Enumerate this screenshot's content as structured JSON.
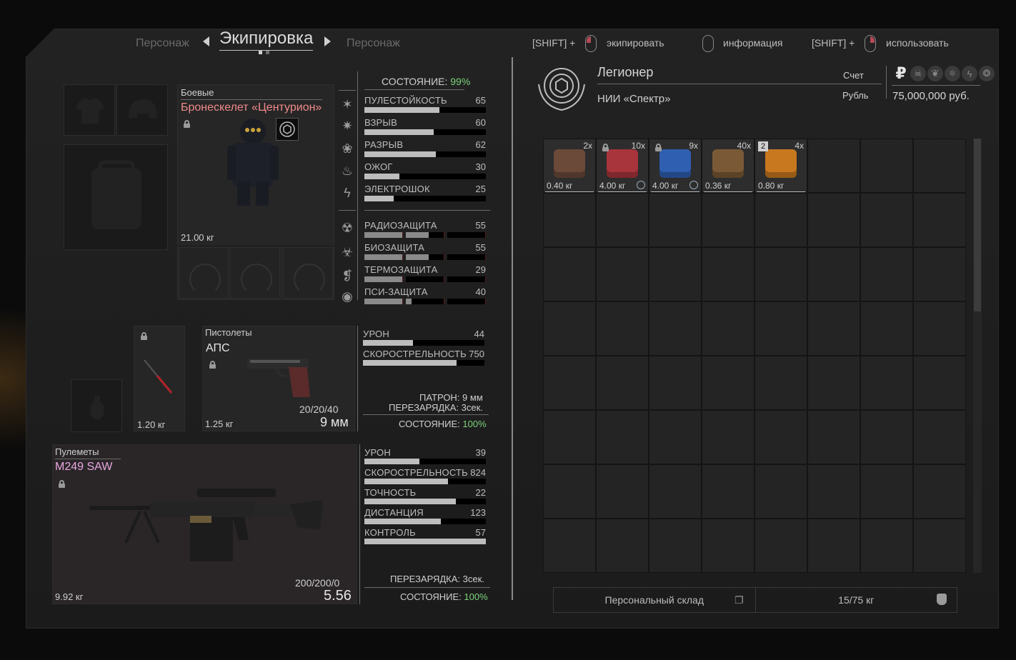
{
  "nav": {
    "left_tab": "Персонаж",
    "current_tab": "Экипировка",
    "right_tab": "Персонаж"
  },
  "hints": [
    {
      "prefix": "[SHIFT] +",
      "label": "экипировать"
    },
    {
      "prefix": "",
      "label": "информация"
    },
    {
      "prefix": "[SHIFT] +",
      "label": "использовать"
    }
  ],
  "profile": {
    "name": "Легионер",
    "faction": "НИИ «Спектр»",
    "account_label": "Счет",
    "currency_label": "Рубль",
    "balance": "75,000,000 руб.",
    "currency_symbol": "₽"
  },
  "armor": {
    "category": "Боевые",
    "name": "Бронескелет «Центурион»",
    "weight": "21.00 кг",
    "condition_label": "СОСТОЯНИЕ:",
    "condition_value": "99%",
    "protection": [
      {
        "label": "ПУЛЕСТОЙКОСТЬ",
        "value": "65",
        "fill": 0.62
      },
      {
        "label": "ВЗРЫВ",
        "value": "60",
        "fill": 0.57
      },
      {
        "label": "РАЗРЫВ",
        "value": "62",
        "fill": 0.59
      },
      {
        "label": "ОЖОГ",
        "value": "30",
        "fill": 0.29
      },
      {
        "label": "ЭЛЕКТРОШОК",
        "value": "25",
        "fill": 0.24
      }
    ],
    "resistance": [
      {
        "label": "РАДИОЗАЩИТА",
        "value": "55",
        "fill": [
          1.0,
          0.6,
          0.0
        ]
      },
      {
        "label": "БИОЗАЩИТА",
        "value": "55",
        "fill": [
          1.0,
          0.6,
          0.0
        ]
      },
      {
        "label": "ТЕРМОЗАЩИТА",
        "value": "29",
        "fill": [
          1.0,
          0.0,
          0.0
        ]
      },
      {
        "label": "ПСИ-ЗАЩИТА",
        "value": "40",
        "fill": [
          1.0,
          0.15,
          0.0
        ]
      }
    ]
  },
  "knife": {
    "weight": "1.20 кг"
  },
  "pistol": {
    "category": "Пистолеты",
    "name": "АПС",
    "weight": "1.25 кг",
    "ammo": "20/20/40",
    "caliber": "9 мм",
    "stats": [
      {
        "label": "УРОН",
        "value": "44",
        "fill": 0.41
      },
      {
        "label": "СКОРОСТРЕЛЬНОСТЬ",
        "value": "750",
        "fill": 0.77
      }
    ],
    "ammo_label": "ПАТРОН: 9 мм",
    "reload_label": "ПЕРЕЗАРЯДКА: 3сек.",
    "condition_label": "СОСТОЯНИЕ:",
    "condition_value": "100%"
  },
  "mg": {
    "category": "Пулеметы",
    "name": "M249 SAW",
    "weight": "9.92 кг",
    "ammo": "200/200/0",
    "caliber": "5.56",
    "stats": [
      {
        "label": "УРОН",
        "value": "39",
        "fill": 0.45
      },
      {
        "label": "СКОРОСТРЕЛЬНОСТЬ",
        "value": "824",
        "fill": 0.69
      },
      {
        "label": "ТОЧНОСТЬ",
        "value": "22",
        "fill": 0.75
      },
      {
        "label": "ДИСТАНЦИЯ",
        "value": "123",
        "fill": 0.63
      },
      {
        "label": "КОНТРОЛЬ",
        "value": "57",
        "fill": 1.0
      }
    ],
    "reload_label": "ПЕРЕЗАРЯДКА: 3сек.",
    "condition_label": "СОСТОЯНИЕ:",
    "condition_value": "100%"
  },
  "inventory": {
    "items": [
      {
        "count": "2x",
        "weight": "0.40 кг",
        "icon": "tape-roll-icon",
        "locked": false,
        "timer": false,
        "color": "#6b4a3a"
      },
      {
        "count": "10x",
        "weight": "4.00 кг",
        "icon": "red-medkit-icon",
        "locked": true,
        "timer": true,
        "color": "#a8343c"
      },
      {
        "count": "9x",
        "weight": "4.00 кг",
        "icon": "blue-medkit-icon",
        "locked": true,
        "timer": true,
        "color": "#2f5fb0"
      },
      {
        "count": "40x",
        "weight": "0.36 кг",
        "icon": "ammo-icon",
        "locked": false,
        "timer": false,
        "color": "#7a5a36"
      },
      {
        "count": "4x",
        "weight": "0.80 кг",
        "icon": "document-folder-icon",
        "locked": false,
        "timer": false,
        "badge": "2",
        "color": "#c8781e"
      }
    ],
    "storage_label": "Персональный склад",
    "capacity": "15/75 кг"
  }
}
